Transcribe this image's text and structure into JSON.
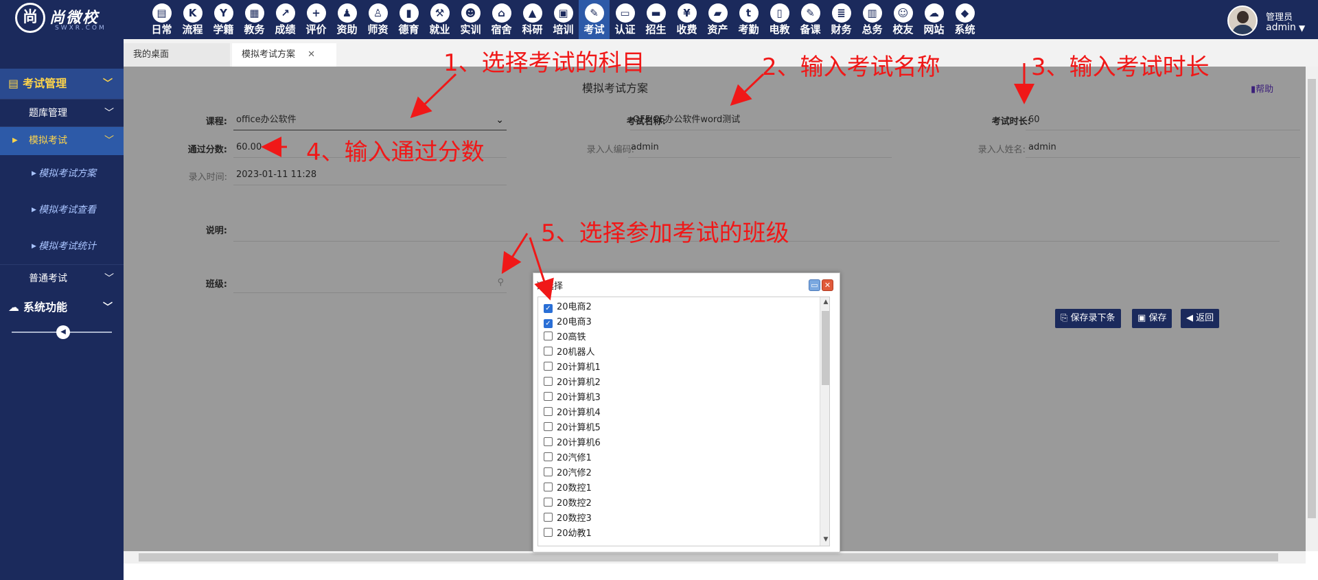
{
  "logo": {
    "mark": "尚",
    "name": "尚微校",
    "sub": "SWXR.COM"
  },
  "nav": [
    {
      "label": "日常",
      "icon": "calendar-icon",
      "glyph": "▤"
    },
    {
      "label": "流程",
      "icon": "flow-icon",
      "glyph": "K"
    },
    {
      "label": "学籍",
      "icon": "student-icon",
      "glyph": "Y"
    },
    {
      "label": "教务",
      "icon": "schedule-icon",
      "glyph": "▦"
    },
    {
      "label": "成绩",
      "icon": "chart-line-icon",
      "glyph": "↗"
    },
    {
      "label": "评价",
      "icon": "evaluation-icon",
      "glyph": "+"
    },
    {
      "label": "资助",
      "icon": "funding-icon",
      "glyph": "♟"
    },
    {
      "label": "师资",
      "icon": "teacher-icon",
      "glyph": "♙"
    },
    {
      "label": "德育",
      "icon": "book-icon",
      "glyph": "▮"
    },
    {
      "label": "就业",
      "icon": "hammer-icon",
      "glyph": "⚒"
    },
    {
      "label": "实训",
      "icon": "training-icon",
      "glyph": "☻"
    },
    {
      "label": "宿舍",
      "icon": "home-icon",
      "glyph": "⌂"
    },
    {
      "label": "科研",
      "icon": "graduation-icon",
      "glyph": "▲"
    },
    {
      "label": "培训",
      "icon": "image-icon",
      "glyph": "▣"
    },
    {
      "label": "考试",
      "icon": "wrench-icon",
      "glyph": "✎"
    },
    {
      "label": "认证",
      "icon": "monitor-icon",
      "glyph": "▭"
    },
    {
      "label": "招生",
      "icon": "bus-icon",
      "glyph": "▬"
    },
    {
      "label": "收费",
      "icon": "yen-icon",
      "glyph": "¥"
    },
    {
      "label": "资产",
      "icon": "train-icon",
      "glyph": "▰"
    },
    {
      "label": "考勤",
      "icon": "attendance-icon",
      "glyph": "t"
    },
    {
      "label": "电教",
      "icon": "media-icon",
      "glyph": "▯"
    },
    {
      "label": "备课",
      "icon": "edit-icon",
      "glyph": "✎"
    },
    {
      "label": "财务",
      "icon": "news-icon",
      "glyph": "≣"
    },
    {
      "label": "总务",
      "icon": "bar-chart-icon",
      "glyph": "▥"
    },
    {
      "label": "校友",
      "icon": "group-icon",
      "glyph": "☺"
    },
    {
      "label": "网站",
      "icon": "cloud-icon",
      "glyph": "☁"
    },
    {
      "label": "系统",
      "icon": "cube-icon",
      "glyph": "◆"
    }
  ],
  "user": {
    "role": "管理员",
    "name": "admin"
  },
  "sidebar": {
    "group1": "考试管理",
    "items": [
      {
        "label": "题库管理"
      },
      {
        "label": "模拟考试"
      },
      {
        "label": "普通考试"
      }
    ],
    "subs": [
      {
        "label": "模拟考试方案"
      },
      {
        "label": "模拟考试查看"
      },
      {
        "label": "模拟考试统计"
      }
    ],
    "group2": "系统功能"
  },
  "tabs": [
    {
      "label": "我的桌面"
    },
    {
      "label": "模拟考试方案"
    }
  ],
  "form": {
    "title": "模拟考试方案",
    "help": "帮助",
    "course_label": "课程:",
    "course_value": "office办公软件",
    "exam_name_label": "考试名称:",
    "exam_name_value": "OFFICE办公软件word测试",
    "duration_label": "考试时长:",
    "duration_value": "60",
    "pass_label": "通过分数:",
    "pass_value": "60.00",
    "entry_code_label": "录入人编码:",
    "entry_code_value": "admin",
    "entry_name_label": "录入人姓名:",
    "entry_name_value": "admin",
    "entry_time_label": "录入时间:",
    "entry_time_value": "2023-01-11 11:28",
    "note_label": "说明:",
    "class_label": "班级:"
  },
  "buttons": {
    "save_next": "保存录下条",
    "save": "保存",
    "back": "返回"
  },
  "dialog": {
    "title": "请选择",
    "options": [
      {
        "label": "20电商2",
        "checked": true
      },
      {
        "label": "20电商3",
        "checked": true
      },
      {
        "label": "20高铁",
        "checked": false
      },
      {
        "label": "20机器人",
        "checked": false
      },
      {
        "label": "20计算机1",
        "checked": false
      },
      {
        "label": "20计算机2",
        "checked": false
      },
      {
        "label": "20计算机3",
        "checked": false
      },
      {
        "label": "20计算机4",
        "checked": false
      },
      {
        "label": "20计算机5",
        "checked": false
      },
      {
        "label": "20计算机6",
        "checked": false
      },
      {
        "label": "20汽修1",
        "checked": false
      },
      {
        "label": "20汽修2",
        "checked": false
      },
      {
        "label": "20数控1",
        "checked": false
      },
      {
        "label": "20数控2",
        "checked": false
      },
      {
        "label": "20数控3",
        "checked": false
      },
      {
        "label": "20幼教1",
        "checked": false
      }
    ]
  },
  "annotations": [
    {
      "text": "1、选择考试的科目"
    },
    {
      "text": "2、输入考试名称"
    },
    {
      "text": "3、输入考试时长"
    },
    {
      "text": "4、输入通过分数"
    },
    {
      "text": "5、选择参加考试的班级"
    }
  ],
  "colors": {
    "topbar": "#1b2a5c",
    "accent": "#2d5aa8",
    "annotation": "#f01818",
    "content_bg": "#9a9a9a"
  }
}
